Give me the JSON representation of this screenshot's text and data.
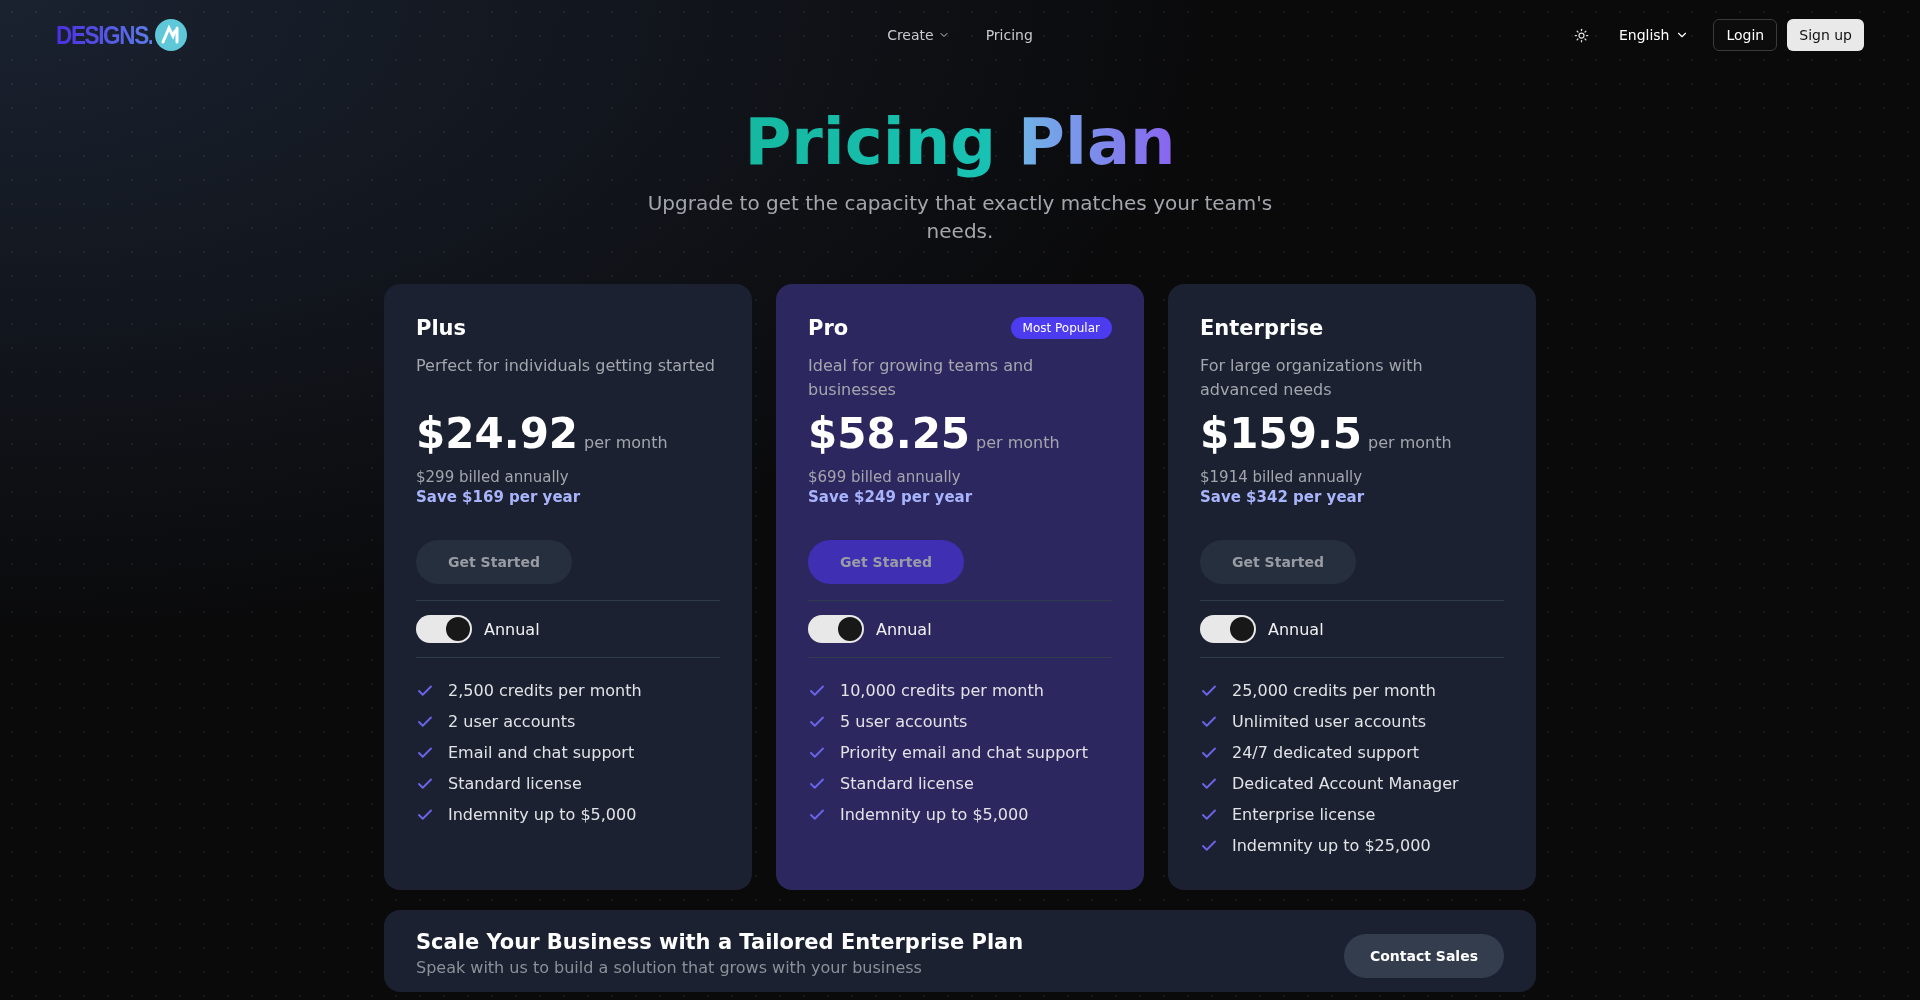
{
  "header": {
    "logo": {
      "text": "DESIGNS."
    },
    "nav": [
      {
        "label": "Create",
        "dropdown": true
      },
      {
        "label": "Pricing",
        "dropdown": false
      }
    ],
    "language": "English",
    "login": "Login",
    "signup": "Sign up"
  },
  "hero": {
    "title_parts": [
      "Pricing",
      "Plan"
    ],
    "subtitle": "Upgrade to get the capacity that exactly matches your team's needs."
  },
  "plans": [
    {
      "name": "Plus",
      "highlighted": false,
      "description": "Perfect for individuals getting started",
      "price": "$24.92",
      "period": "per month",
      "billed": "$299 billed annually",
      "save": "Save $169 per year",
      "button": "Get Started",
      "toggle": {
        "label": "Annual",
        "on": true
      },
      "features": [
        "2,500 credits per month",
        "2 user accounts",
        "Email and chat support",
        "Standard license",
        "Indemnity up to $5,000"
      ]
    },
    {
      "name": "Pro",
      "highlighted": true,
      "badge": "Most Popular",
      "description": "Ideal for growing teams and businesses",
      "price": "$58.25",
      "period": "per month",
      "billed": "$699 billed annually",
      "save": "Save $249 per year",
      "button": "Get Started",
      "toggle": {
        "label": "Annual",
        "on": true
      },
      "features": [
        "10,000 credits per month",
        "5 user accounts",
        "Priority email and chat support",
        "Standard license",
        "Indemnity up to $5,000"
      ]
    },
    {
      "name": "Enterprise",
      "highlighted": false,
      "description": "For large organizations with advanced needs",
      "price": "$159.5",
      "period": "per month",
      "billed": "$1914 billed annually",
      "save": "Save $342 per year",
      "button": "Get Started",
      "toggle": {
        "label": "Annual",
        "on": true
      },
      "features": [
        "25,000 credits per month",
        "Unlimited user accounts",
        "24/7 dedicated support",
        "Dedicated Account Manager",
        "Enterprise license",
        "Indemnity up to $25,000"
      ]
    }
  ],
  "enterprise_banner": {
    "title": "Scale Your Business with a Tailored Enterprise Plan",
    "subtitle": "Speak with us to build a solution that grows with your business",
    "button": "Contact Sales"
  }
}
